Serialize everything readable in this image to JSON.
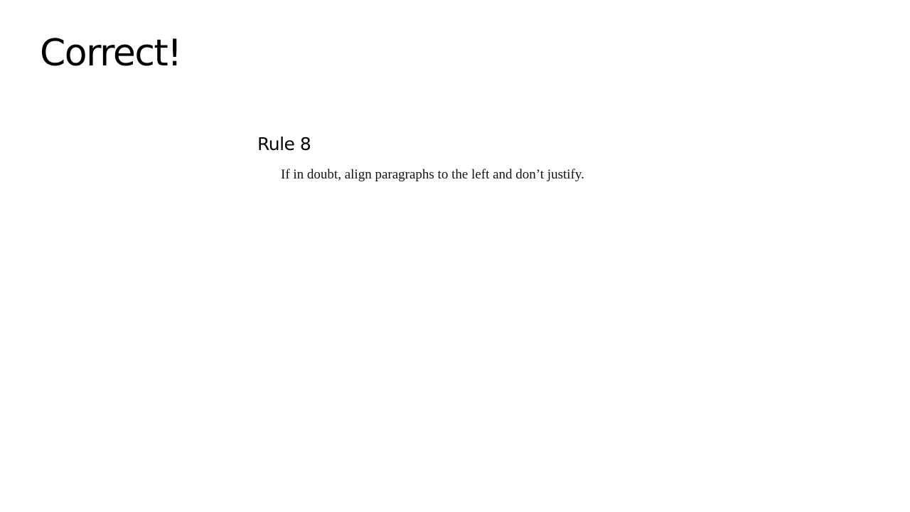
{
  "result": {
    "heading": "Correct!"
  },
  "rule": {
    "title": "Rule 8",
    "text": "If in doubt, align paragraphs to the left and don’t justify."
  }
}
